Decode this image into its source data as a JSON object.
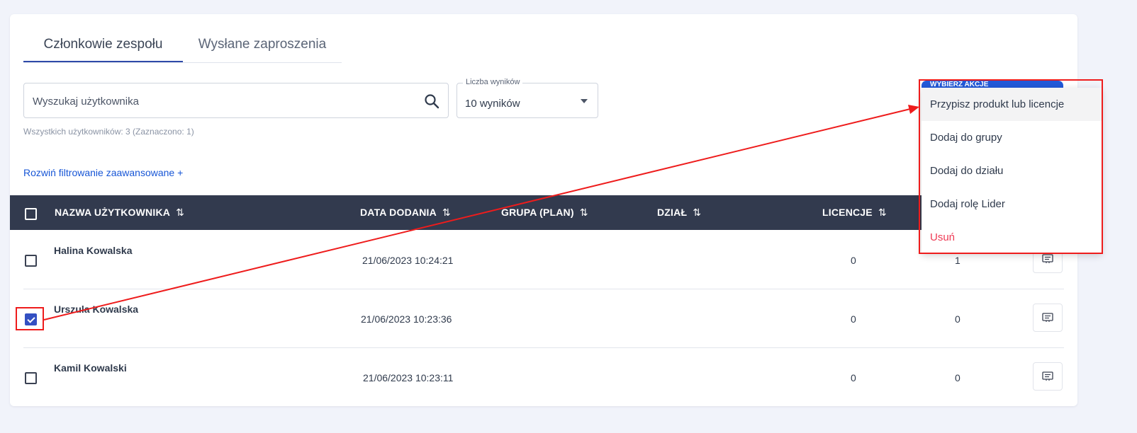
{
  "tabs": [
    {
      "label": "Członkowie zespołu",
      "active": true
    },
    {
      "label": "Wysłane zaproszenia",
      "active": false
    }
  ],
  "search": {
    "placeholder": "Wyszukaj użytkownika",
    "icon": "search-icon"
  },
  "results_select": {
    "legend": "Liczba wyników",
    "value": "10 wyników"
  },
  "user_count": "Wszystkich użytkowników: 3 (Zaznaczono: 1)",
  "advanced_filter_link": "Rozwiń filtrowanie zaawansowane +",
  "table": {
    "headers": {
      "name": "NAZWA UŻYTKOWNIKA",
      "date": "DATA DODANIA",
      "group": "GRUPA (PLAN)",
      "dept": "DZIAŁ",
      "licenses": "LICENCJE"
    },
    "sort_icon": "⇅",
    "rows": [
      {
        "name": "Halina Kowalska",
        "date": "21/06/2023 10:24:21",
        "licenses": "0",
        "col6": "1",
        "checked": false
      },
      {
        "name": "Urszula Kowalska",
        "date": "21/06/2023 10:23:36",
        "licenses": "0",
        "col6": "0",
        "checked": true
      },
      {
        "name": "Kamil Kowalski",
        "date": "21/06/2023 10:23:11",
        "licenses": "0",
        "col6": "0",
        "checked": false
      }
    ]
  },
  "actions_menu": {
    "button_label": "WYBIERZ AKCJE",
    "items": [
      "Przypisz produkt lub licencje",
      "Dodaj do grupy",
      "Dodaj do działu",
      "Dodaj rolę Lider",
      "Usuń"
    ]
  },
  "colors": {
    "accent": "#2e4aa8",
    "header_bg": "#323a4e",
    "danger": "#ee3a54",
    "highlight": "#ee1c1c",
    "link": "#1756d6"
  }
}
